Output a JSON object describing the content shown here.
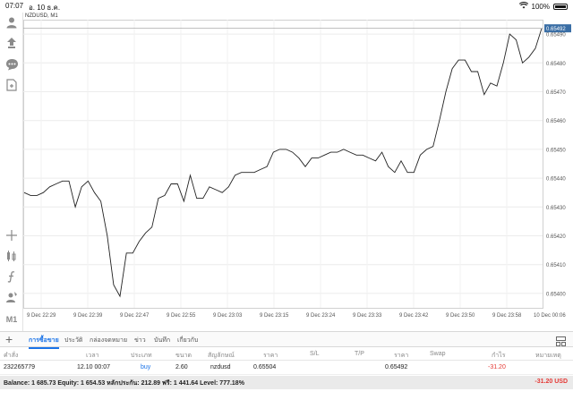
{
  "status_bar": {
    "time": "07:07",
    "date": "อ. 10 ธ.ค.",
    "battery": "100%"
  },
  "chart": {
    "title": "NZDUSD, M1",
    "current_price": "0.65492",
    "line_color": "#222222",
    "price_tag_color": "#3a6ea5"
  },
  "toolbar": {
    "tools": [
      "account-icon",
      "trade-icon",
      "chat-icon",
      "news-icon",
      "crosshair-icon",
      "indicators-icon",
      "function-icon",
      "objects-icon",
      "timeframe"
    ],
    "timeframe_label": "M1"
  },
  "chart_data": {
    "type": "line",
    "symbol": "NZDUSD",
    "timeframe": "M1",
    "y_ticks": [
      "0.65490",
      "0.65480",
      "0.65470",
      "0.65460",
      "0.65450",
      "0.65440",
      "0.65430",
      "0.65420",
      "0.65410",
      "0.65400"
    ],
    "x_ticks": [
      "9 Dec 22:29",
      "9 Dec 22:39",
      "9 Dec 22:47",
      "9 Dec 22:55",
      "9 Dec 23:03",
      "9 Dec 23:15",
      "9 Dec 23:24",
      "9 Dec 23:33",
      "9 Dec 23:42",
      "9 Dec 23:50",
      "9 Dec 23:58",
      "10 Dec 00:06"
    ],
    "ylim": [
      0.65395,
      0.65495
    ],
    "series": [
      {
        "values": [
          0.65435,
          0.65434,
          0.65434,
          0.65435,
          0.65437,
          0.65438,
          0.65439,
          0.65439,
          0.6543,
          0.65437,
          0.65439,
          0.65435,
          0.65432,
          0.6542,
          0.65403,
          0.65399,
          0.65414,
          0.65414,
          0.65418,
          0.65421,
          0.65423,
          0.65433,
          0.65434,
          0.65438,
          0.65438,
          0.65432,
          0.65441,
          0.65433,
          0.65433,
          0.65437,
          0.65436,
          0.65435,
          0.65437,
          0.65441,
          0.65442,
          0.65442,
          0.65442,
          0.65443,
          0.65444,
          0.65449,
          0.6545,
          0.6545,
          0.65449,
          0.65447,
          0.65444,
          0.65447,
          0.65447,
          0.65448,
          0.65449,
          0.65449,
          0.6545,
          0.65449,
          0.65448,
          0.65448,
          0.65447,
          0.65446,
          0.65449,
          0.65444,
          0.65442,
          0.65446,
          0.65442,
          0.65442,
          0.65448,
          0.6545,
          0.65451,
          0.6546,
          0.6547,
          0.65478,
          0.65481,
          0.65481,
          0.65477,
          0.65477,
          0.65469,
          0.65473,
          0.65472,
          0.6548,
          0.6549,
          0.65488,
          0.6548,
          0.65482,
          0.65485,
          0.65492
        ]
      }
    ],
    "grid": true
  },
  "tabs": {
    "items": [
      "การซื้อขาย",
      "ประวัติ",
      "กล่องจดหมาย",
      "ข่าว",
      "บันทึก",
      "เกี่ยวกับ"
    ],
    "active": "การซื้อขาย"
  },
  "positions": {
    "columns": [
      "คำสั่ง",
      "เวลา",
      "ประเภท",
      "ขนาด",
      "สัญลักษณ์",
      "ราคา",
      "S/L",
      "T/P",
      "ราคา",
      "Swap",
      "กำไร",
      "หมายเหตุ"
    ],
    "rows": [
      {
        "order": "232265779",
        "time": "12.10 00:07",
        "type": "buy",
        "size": "2.60",
        "symbol": "nzdusd",
        "price": "0.65504",
        "sl": "",
        "tp": "",
        "current_price": "0.65492",
        "swap": "",
        "profit": "-31.20",
        "comment": ""
      }
    ]
  },
  "summary": {
    "text": "Balance: 1 685.73 Equity: 1 654.53 หลักประกัน: 212.89 ฟรี: 1 441.64 Level: 777.18%",
    "pl": "-31.20  USD"
  }
}
